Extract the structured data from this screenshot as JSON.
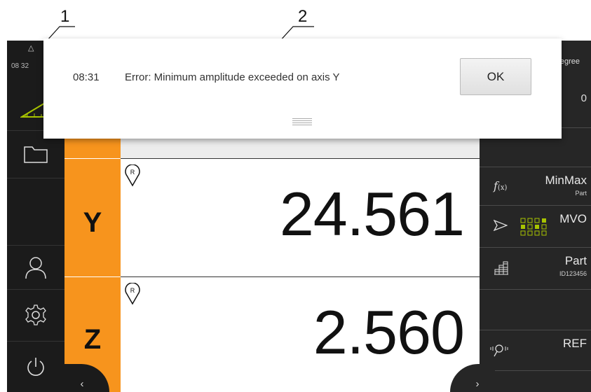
{
  "callouts": [
    "1",
    "2"
  ],
  "sidebar": {
    "status_time": "08 32",
    "items": [
      {
        "name": "measure-icon"
      },
      {
        "name": "folder-icon"
      },
      {
        "name": "user-icon"
      },
      {
        "name": "settings-icon"
      },
      {
        "name": "power-icon"
      }
    ]
  },
  "axes": [
    {
      "letter": "Y",
      "value": "24.561",
      "ref_label": "R"
    },
    {
      "letter": "Z",
      "value": "2.560",
      "ref_label": "R"
    }
  ],
  "right_panel": {
    "top_partial_label": "egree",
    "top_value": "0",
    "items": [
      {
        "icon": "function-icon",
        "label": "MinMax",
        "sub": "Part"
      },
      {
        "icon": "send-icon",
        "label": "MVO",
        "sub": ""
      },
      {
        "icon": "part-grid-icon",
        "label": "Part",
        "sub": "ID123456"
      },
      {
        "icon": "",
        "label": "",
        "sub": ""
      },
      {
        "icon": "probe-icon",
        "label": "REF",
        "sub": ""
      }
    ]
  },
  "dialog": {
    "time": "08:31",
    "message": "Error: Minimum amplitude exceeded on axis Y",
    "ok_label": "OK"
  },
  "colors": {
    "axis_tab": "#f7941d",
    "sidebar_bg": "#1b1b1b",
    "panel_bg": "#262626",
    "accent_green": "#a8c400"
  }
}
